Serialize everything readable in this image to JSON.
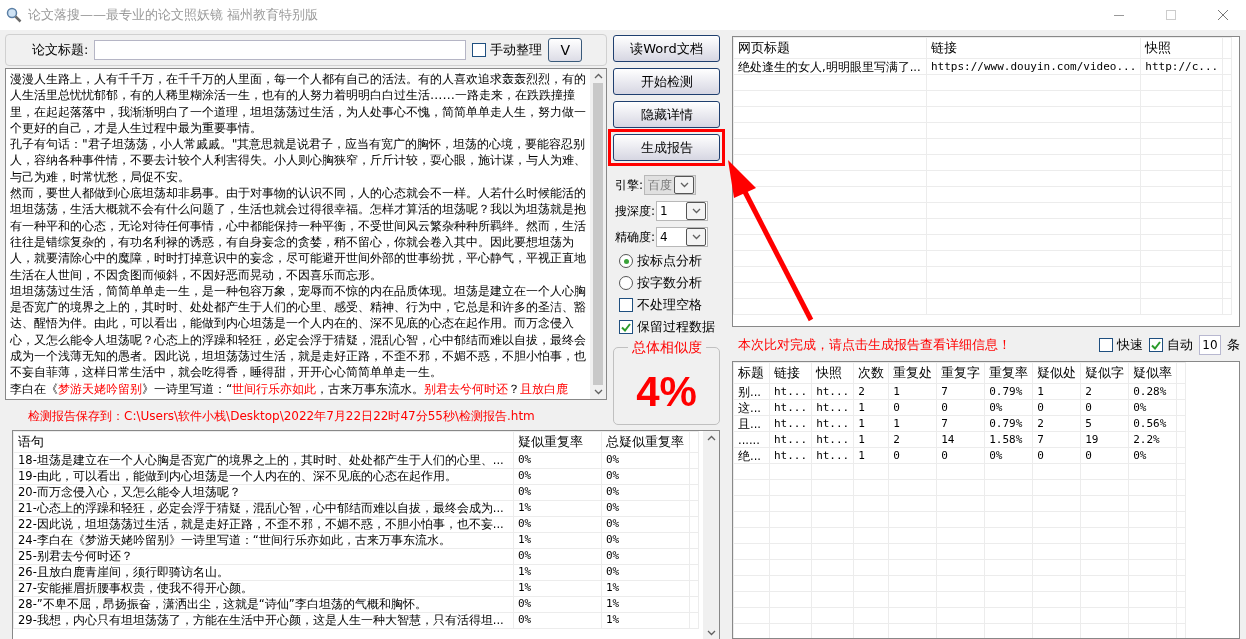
{
  "window": {
    "title": "论文落搜——最专业的论文照妖镜 福州教育特别版"
  },
  "title_field": {
    "label": "论文标题:"
  },
  "manual_checkbox": {
    "label": "手动整理",
    "checked": false
  },
  "v_button": "V",
  "document": [
    [
      {
        "text": "漫漫人生路上，人有千千万，在千千万的人里面，每一个人都有自己的活法。有的人喜欢追求轰轰烈烈，有的人生活里总忧忧郁郁，有的人稀里糊涂活一生，也有的人努力着明明白白过生活……一路走来，在跌跌撞撞里，在起起落落中，我渐渐明白了一个道理，坦坦荡荡过生活，为人处事心不愧，简简单单走人生，努力做一个更好的自己，才是人生过程中最为重要事情。",
        "highlighted": false
      }
    ],
    [
      {
        "text": "孔子有句话：\"君子坦荡荡，小人常戚戚。\"其意思就是说君子，应当有宽广的胸怀，坦荡的心境，要能容忍别人，容纳各种事件情，不要去计较个人利害得失。小人则心胸狭窄，斤斤计较，耍心眼，施计谋，与人为难、与己为难，时常忧愁，局促不安。",
        "highlighted": false
      }
    ],
    [
      {
        "text": "然而，要世人都做到心底坦荡却非易事。由于对事物的认识不同，人的心态就会不一样。人若什么时候能活的坦坦荡荡，生活大概就不会有什么问题了，生活也就会过得很幸福。怎样才算活的坦荡呢？我以为坦荡就是抱有一种平和的心态，无论对待任何事情，心中都能保持一种平衡，不受世间风云繁杂种种所羁绊。然而，生活往往是错综复杂的，有功名利禄的诱惑，有自身妄念的贪婪，稍不留心，你就会卷入其中。因此要想坦荡为人，就要清除心中的魔障，时时打掉意识中的妄念，尽可能避开世间外部的世事纷扰，平心静气，平视正直地生活在人世间，不因贪图而倾斜，不因好恶而晃动，不因喜乐而忘形。",
        "highlighted": false
      }
    ],
    [
      {
        "text": "坦坦荡荡过生活，简简单单走一生，是一种包容万象，宠辱而不惊的内在品质体现。坦荡是建立在一个人心胸是否宽广的境界之上的，其时时、处处都产生于人们的心里、感受、精神、行为中，它总是和许多的圣洁、豁达、醒悟为伴。由此，可以看出，能做到内心坦荡是一个人内在的、深不见底的心态在起作用。而万念侵入心，又怎么能令人坦荡呢？心态上的浮躁和轻狂，必定会浮于猜疑，混乱心智，心中郁结而难以自拔，最终会成为一个浅薄无知的愚者。因此说，坦坦荡荡过生活，就是走好正路，不歪不邪，不媚不惑，不胆小怕事，也不妄自菲薄，这样日常生活中，就会吃得香，睡得甜，开开心心简简单单走一生。",
        "highlighted": false
      }
    ],
    [
      {
        "text": "李白在《",
        "highlighted": false
      },
      {
        "text": "梦游天姥吟留别",
        "highlighted": true
      },
      {
        "text": "》一诗里写道：“",
        "highlighted": false
      },
      {
        "text": "世间行乐亦如此",
        "highlighted": true
      },
      {
        "text": "，古来万事东流水。",
        "highlighted": false
      },
      {
        "text": "别君去兮何时还",
        "highlighted": true
      },
      {
        "text": "？",
        "highlighted": false
      },
      {
        "text": "且放白鹿",
        "highlighted": true
      }
    ]
  ],
  "save_path": "检测报告保存到：C:\\Users\\软件小栈\\Desktop\\2022年7月22日22时47分55秒\\检测报告.htm",
  "buttons": [
    {
      "label": "读Word文档",
      "annotated": false
    },
    {
      "label": "开始检测",
      "annotated": false
    },
    {
      "label": "隐藏详情",
      "annotated": false
    },
    {
      "label": "生成报告",
      "annotated": true
    }
  ],
  "selects": [
    {
      "label": "引擎:",
      "value": "百度",
      "disabled": true
    },
    {
      "label": "搜深度:",
      "value": "1",
      "disabled": false
    },
    {
      "label": "精确度:",
      "value": "4",
      "disabled": false
    }
  ],
  "radios": [
    {
      "label": "按标点分析",
      "selected": true
    },
    {
      "label": "按字数分析",
      "selected": false
    }
  ],
  "options": [
    {
      "label": "不处理空格",
      "checked": false
    },
    {
      "label": "保留过程数据",
      "checked": true
    }
  ],
  "similarity": {
    "title": "总体相似度",
    "value": "4%"
  },
  "sentence_table": {
    "columns": [
      "语句",
      "疑似重复率",
      "总疑似重复率"
    ],
    "rows": [
      [
        "18-坦荡是建立在一个人心胸是否宽广的境界之上的，其时时、处处都产生于人们的心里、...",
        "0%",
        "0%"
      ],
      [
        "19-由此，可以看出，能做到内心坦荡是一个人内在的、深不见底的心态在起作用。",
        "0%",
        "0%"
      ],
      [
        "20-而万念侵入心，又怎么能令人坦荡呢？",
        "0%",
        "0%"
      ],
      [
        "21-心态上的浮躁和轻狂，必定会浮于猜疑，混乱心智，心中郁结而难以自拔，最终会成为...",
        "1%",
        "0%"
      ],
      [
        "22-因此说，坦坦荡荡过生活，就是走好正路，不歪不邪，不媚不惑，不胆小怕事，也不妄...",
        "0%",
        "0%"
      ],
      [
        "24-李白在《梦游天姥吟留别》一诗里写道：“世间行乐亦如此，古来万事东流水。",
        "1%",
        "0%"
      ],
      [
        "25-别君去兮何时还？",
        "0%",
        "0%"
      ],
      [
        "26-且放白鹿青崖间，须行即骑访名山。",
        "1%",
        "0%"
      ],
      [
        "27-安能摧眉折腰事权贵，使我不得开心颜。",
        "1%",
        "1%"
      ],
      [
        "28-”不卑不屈，昂扬振奋，潇洒出尘，这就是“诗仙”李白坦荡的气概和胸怀。",
        "0%",
        "1%"
      ],
      [
        "29-我想，内心只有坦坦荡荡了，方能在生活中开心颜，这是人生一种大智慧，只有活得坦...",
        "0%",
        "1%"
      ]
    ]
  },
  "web_table": {
    "columns": [
      "网页标题",
      "链接",
      "快照"
    ],
    "rows": [
      [
        "绝处逢生的女人,明明眼里写满了...",
        "https://www.douyin.com/video...",
        "http://c..."
      ]
    ]
  },
  "message": "本次比对完成，请点击生成报告查看详细信息！",
  "fast_checkbox": {
    "label": "快速",
    "checked": false
  },
  "auto_checkbox": {
    "label": "自动",
    "checked": true
  },
  "auto_count": {
    "value": "10",
    "unit": "条"
  },
  "result_table": {
    "columns": [
      "标题",
      "链接",
      "快照",
      "次数",
      "重复处",
      "重复字",
      "重复率",
      "疑似处",
      "疑似字",
      "疑似率"
    ],
    "rows": [
      [
        "别...",
        "ht...",
        "ht...",
        "2",
        "1",
        "7",
        "0.79%",
        "1",
        "2",
        "0.28%"
      ],
      [
        "这...",
        "ht...",
        "ht...",
        "1",
        "0",
        "0",
        "0%",
        "0",
        "0",
        "0%"
      ],
      [
        "且...",
        "ht...",
        "ht...",
        "1",
        "1",
        "7",
        "0.79%",
        "2",
        "5",
        "0.56%"
      ],
      [
        "......",
        "ht...",
        "ht...",
        "1",
        "2",
        "14",
        "1.58%",
        "7",
        "19",
        "2.2%"
      ],
      [
        "绝...",
        "ht...",
        "ht...",
        "1",
        "0",
        "0",
        "0%",
        "0",
        "0",
        "0%"
      ]
    ]
  },
  "annotation": {
    "kind": "arrow"
  }
}
